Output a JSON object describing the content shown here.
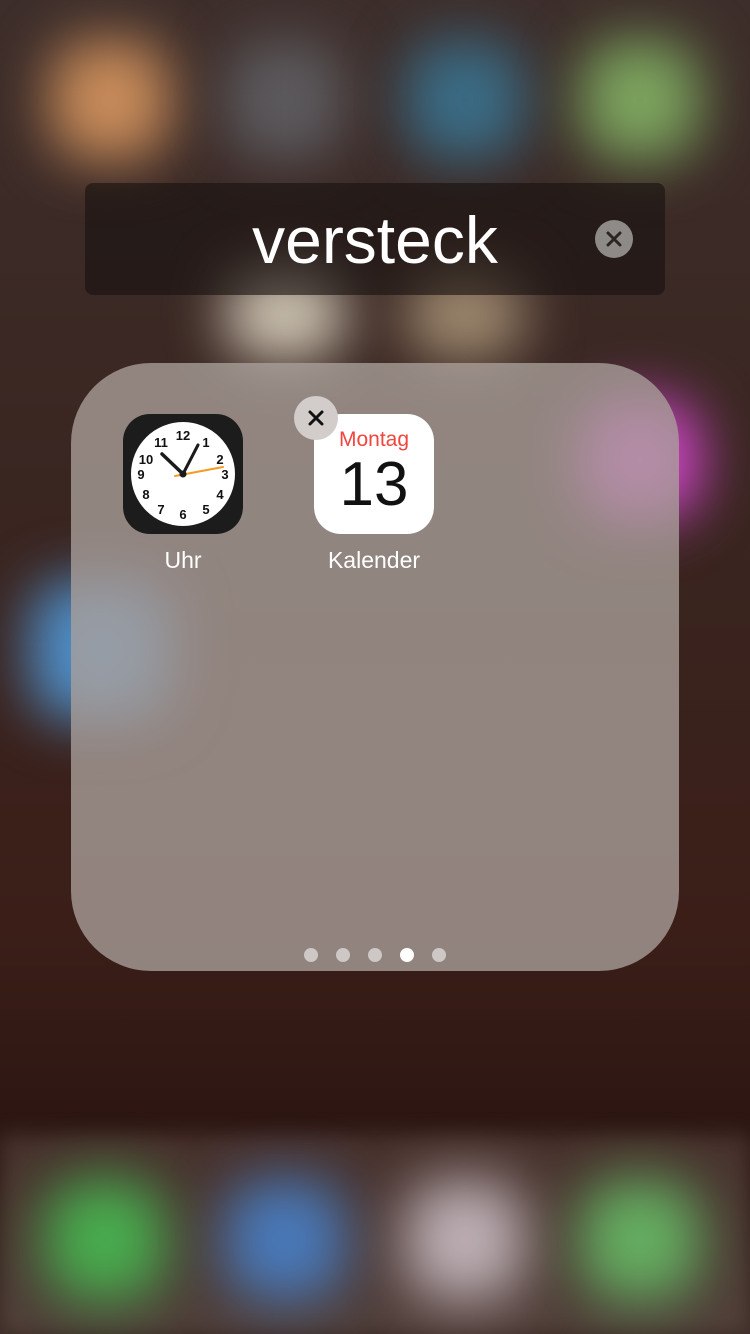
{
  "folder": {
    "name": "versteck",
    "apps": [
      {
        "label": "Uhr",
        "icon": "clock-icon"
      },
      {
        "label": "Kalender",
        "icon": "calendar-icon",
        "weekday": "Montag",
        "date": "13"
      }
    ],
    "page_count": 5,
    "active_page": 4
  },
  "clock": {
    "numbers": [
      "12",
      "1",
      "2",
      "3",
      "4",
      "5",
      "6",
      "7",
      "8",
      "9",
      "10",
      "11"
    ],
    "hand_color": "#1b1b1b",
    "second_hand_color": "#f59a23"
  },
  "colors": {
    "calendar_weekday": "#f2453d",
    "folder_panel": "#aaa09b",
    "name_bar": "#19120f"
  }
}
